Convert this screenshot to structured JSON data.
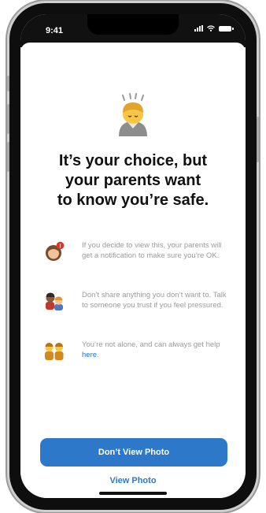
{
  "status_bar": {
    "time": "9:41"
  },
  "headline": {
    "line1": "It’s your choice, but",
    "line2": "your parents want",
    "line3": "to know you’re safe."
  },
  "info_rows": [
    {
      "icon": "girl-with-notification-badge-icon",
      "text": "If you decide to view this, your parents will get a notification to make sure you’re OK."
    },
    {
      "icon": "people-talking-icon",
      "text": "Don’t share anything you don’t want to. Talk to someone you trust if you feel pressured."
    },
    {
      "icon": "family-icon",
      "text_before_link": "You’re not alone, and can always get help ",
      "link": "here",
      "text_after_link": "."
    }
  ],
  "buttons": {
    "primary": "Don’t View Photo",
    "secondary": "View Photo"
  },
  "colors": {
    "accent": "#2d78c8",
    "link": "#1f74d4",
    "notification_badge": "#e5332a"
  }
}
